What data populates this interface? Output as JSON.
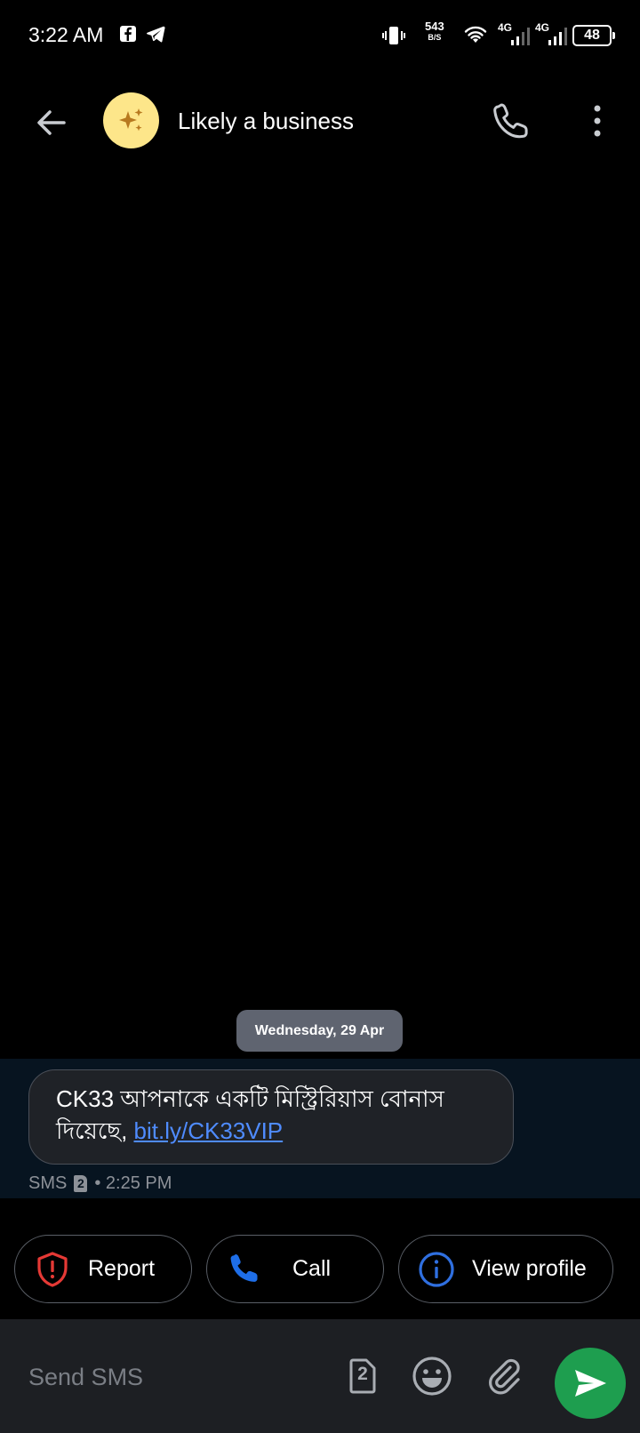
{
  "status_bar": {
    "time": "3:22 AM",
    "net_speed_value": "543",
    "net_speed_unit": "B/S",
    "network_1": "4G",
    "network_2": "4G",
    "battery": "48",
    "app_icons": [
      "facebook-icon",
      "telegram-icon"
    ]
  },
  "header": {
    "contact_name": "Likely a business",
    "avatar_icon": "sparkle-icon",
    "avatar_color": "#fde68a"
  },
  "conversation": {
    "date_label": "Wednesday, 29 Apr",
    "message": {
      "text": "CK33 আপনাকে একটি মিস্ট্রিরিয়াস বোনাস দিয়েছে, ",
      "link": "bit.ly/CK33VIP",
      "type": "SMS",
      "sim": "2",
      "time": "• 2:25 PM"
    }
  },
  "actions": {
    "report": "Report",
    "call": "Call",
    "view_profile": "View profile"
  },
  "composer": {
    "placeholder": "Send SMS",
    "sim": "2"
  },
  "colors": {
    "accent_send": "#1e9e4f",
    "link": "#4f8cff",
    "report_icon": "#e53935",
    "call_icon": "#1e6ee8",
    "info_icon": "#2f6fe0"
  }
}
